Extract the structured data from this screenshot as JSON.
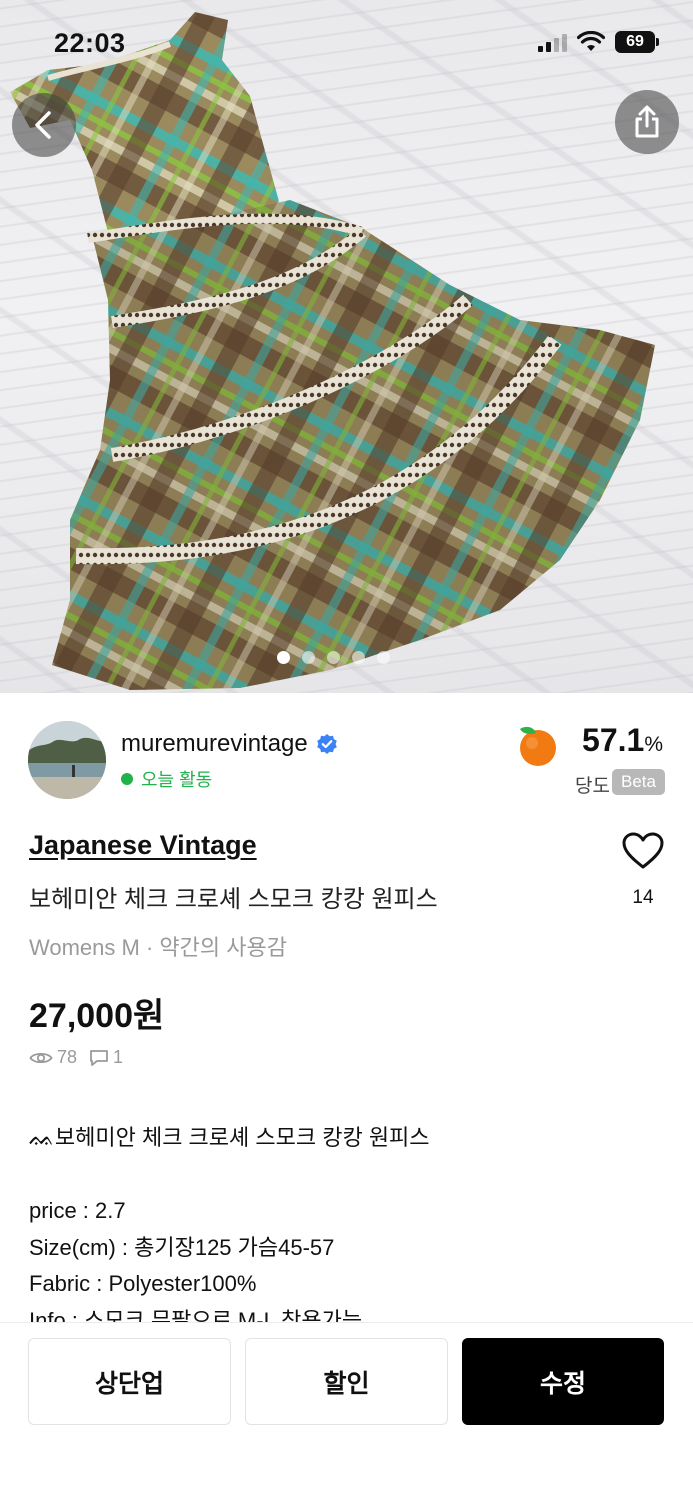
{
  "status_bar": {
    "time": "22:03",
    "battery": "69"
  },
  "gallery": {
    "image_count": 5,
    "active_index": 1,
    "icons": {
      "back": "chevron-left-icon",
      "share": "share-icon"
    }
  },
  "seller": {
    "name": "muremurevintage",
    "activity": "오늘 활동",
    "sweetness_value": "57.1",
    "sweetness_unit": "%",
    "sweetness_label": "당도",
    "beta_badge": "Beta"
  },
  "product": {
    "brand": "Japanese Vintage",
    "title": "보헤미안 체크 크로셰 스모크 캉캉 원피스",
    "meta": "Womens M · 약간의 사용감",
    "price": "27,000원",
    "views": "78",
    "comments": "1",
    "likes": "14"
  },
  "description": {
    "lines": [
      "ᨐ보헤미안 체크 크로셰 스모크 캉캉 원피스",
      "",
      "price : 2.7",
      "Size(cm) : 총기장125 가슴45-57",
      "Fabric : Polyester100%",
      "Info : 스모크 뮤팔으로 M-L 착용가능"
    ]
  },
  "bottom_bar": {
    "bump_label": "상단업",
    "discount_label": "할인",
    "edit_label": "수정"
  },
  "colors": {
    "activity_green": "#22b24c",
    "verified_blue": "#3b82f6",
    "primary_black": "#000000"
  }
}
